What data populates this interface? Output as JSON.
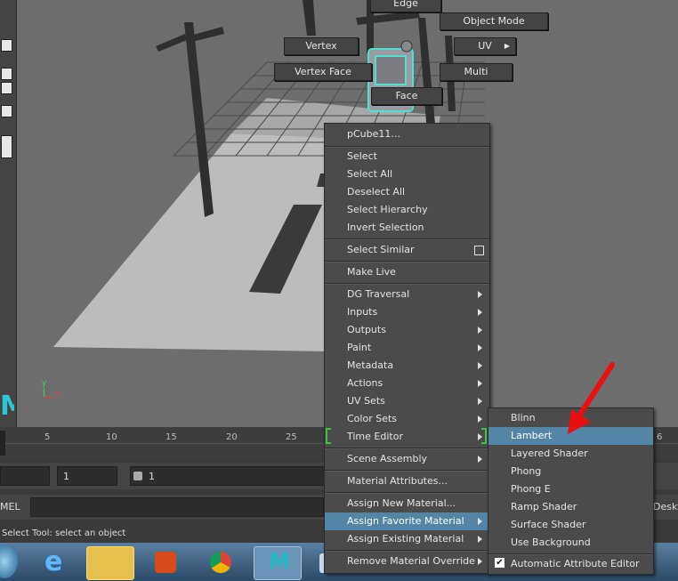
{
  "marking_menu": {
    "edge": "Edge",
    "object_mode": "Object Mode",
    "vertex": "Vertex",
    "uv": "UV",
    "vertex_face": "Vertex Face",
    "multi": "Multi",
    "face": "Face"
  },
  "context_menu": {
    "header": "pCube11...",
    "items": [
      "Select",
      "Select All",
      "Deselect All",
      "Select Hierarchy",
      "Invert Selection",
      "Select Similar",
      "Make Live",
      "DG Traversal",
      "Inputs",
      "Outputs",
      "Paint",
      "Metadata",
      "Actions",
      "UV Sets",
      "Color Sets",
      "Time Editor",
      "Scene Assembly",
      "Material Attributes...",
      "Assign New Material...",
      "Assign Favorite Material",
      "Assign Existing Material",
      "Remove Material Override"
    ]
  },
  "submenu": {
    "items": [
      "Blinn",
      "Lambert",
      "Layered Shader",
      "Phong",
      "Phong E",
      "Ramp Shader",
      "Surface Shader",
      "Use Background"
    ],
    "auto_attr": "Automatic Attribute Editor"
  },
  "timeline": {
    "ticks": [
      "5",
      "10",
      "15",
      "20",
      "25"
    ],
    "right_partial": "6"
  },
  "range": {
    "start": "1",
    "current": "1"
  },
  "mel_label": "MEL",
  "desktop_label": "Deskt",
  "status": "Select Tool: select an object",
  "axis": {
    "y": "y",
    "x": "x"
  },
  "colors": {
    "highlight": "#5285a6",
    "arrow": "#e81010",
    "selection": "#4fe0d0"
  }
}
